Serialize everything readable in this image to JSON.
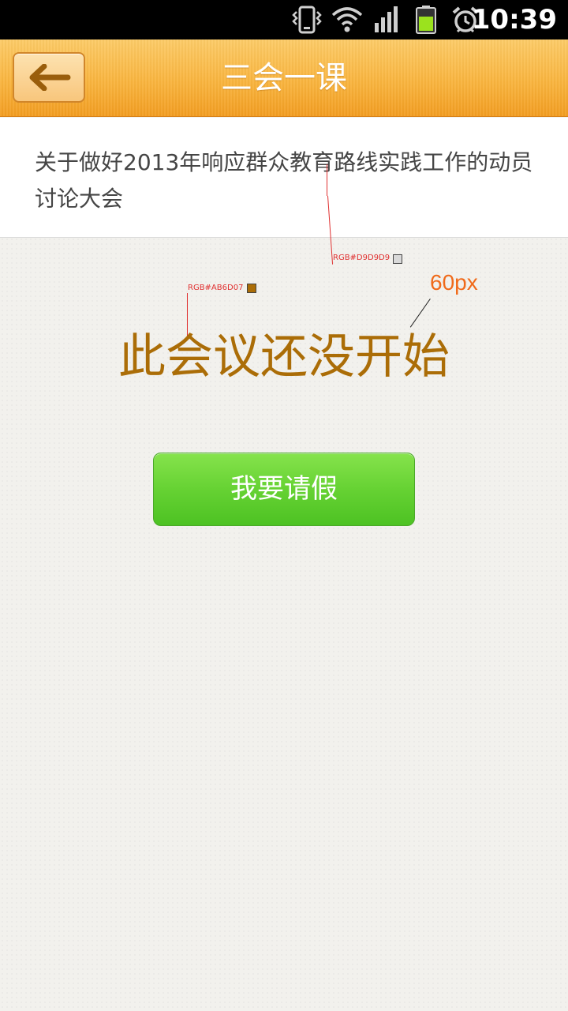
{
  "status_bar": {
    "time": "10:39",
    "icons": [
      "vibrate-icon",
      "wifi-icon",
      "signal-icon",
      "battery-icon",
      "alarm-icon"
    ]
  },
  "header": {
    "title": "三会一课",
    "back_icon": "back-arrow-icon"
  },
  "meeting": {
    "title": "关于做好2013年响应群众教育路线实践工作的动员讨论大会"
  },
  "status_message": "此会议还没开始",
  "leave_button": {
    "label": "我要请假"
  },
  "annotations": {
    "text_color_label": "RGB#AB6D07",
    "text_color": "#AB6D07",
    "divider_color_label": "RGB#D9D9D9",
    "divider_color": "#D9D9D9",
    "font_size_label": "60px"
  },
  "colors": {
    "header_orange": "#f9b43e",
    "button_green": "#66d233",
    "message_brown": "#AB6D07"
  }
}
